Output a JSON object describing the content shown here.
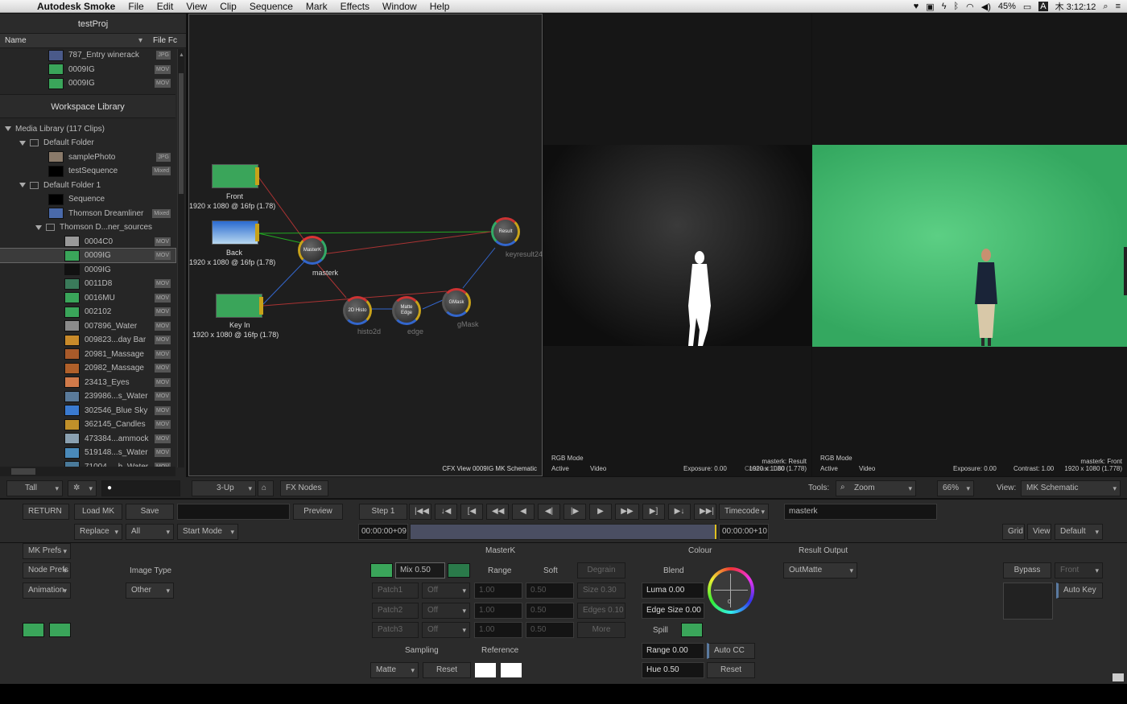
{
  "menubar": {
    "app": "Autodesk Smoke",
    "items": [
      "File",
      "Edit",
      "View",
      "Clip",
      "Sequence",
      "Mark",
      "Effects",
      "Window",
      "Help"
    ],
    "battery": "45%",
    "input": "A",
    "clock": "木 3:12:12"
  },
  "library": {
    "project": "testProj",
    "col_name": "Name",
    "col_format": "File Fc",
    "top_items": [
      {
        "name": "787_Entry winerack",
        "tag": "JPG",
        "thumb": "#4a5a8a"
      },
      {
        "name": "0009IG",
        "tag": "MOV",
        "thumb": "#3aa55a"
      },
      {
        "name": "0009IG",
        "tag": "MOV",
        "thumb": "#3aa55a"
      }
    ],
    "workspace": "Workspace Library",
    "media_root": "Media Library (117 Clips)",
    "folder1": "Default Folder",
    "folder1_items": [
      {
        "name": "samplePhoto",
        "tag": "JPG",
        "thumb": "#8a7a6a"
      },
      {
        "name": "testSequence",
        "tag": "Mixed",
        "thumb": "#000"
      }
    ],
    "folder2": "Default Folder 1",
    "folder2_items": [
      {
        "name": "Sequence",
        "tag": "",
        "thumb": "#000"
      },
      {
        "name": "Thomson Dreamliner",
        "tag": "Mixed",
        "thumb": "#4a6aaa"
      }
    ],
    "subfolder": "Thomson D...ner_sources",
    "clips": [
      {
        "name": "0004C0",
        "tag": "MOV",
        "thumb": "#999"
      },
      {
        "name": "0009IG",
        "tag": "MOV",
        "thumb": "#3aa55a"
      },
      {
        "name": "0009IG",
        "tag": "",
        "thumb": "#111"
      },
      {
        "name": "0011D8",
        "tag": "MOV",
        "thumb": "#3a7a5a"
      },
      {
        "name": "0016MU",
        "tag": "MOV",
        "thumb": "#3aa55a"
      },
      {
        "name": "002102",
        "tag": "MOV",
        "thumb": "#3aa55a"
      },
      {
        "name": "007896_Water",
        "tag": "MOV",
        "thumb": "#8a8a8a"
      },
      {
        "name": "009823...day Bar",
        "tag": "MOV",
        "thumb": "#c88a2a"
      },
      {
        "name": "20981_Massage",
        "tag": "MOV",
        "thumb": "#a85a2a"
      },
      {
        "name": "20982_Massage",
        "tag": "MOV",
        "thumb": "#b0602a"
      },
      {
        "name": "23413_Eyes",
        "tag": "MOV",
        "thumb": "#d07a4a"
      },
      {
        "name": "239986...s_Water",
        "tag": "MOV",
        "thumb": "#5a7a9a"
      },
      {
        "name": "302546_Blue Sky",
        "tag": "MOV",
        "thumb": "#3a7ad0"
      },
      {
        "name": "362145_Candles",
        "tag": "MOV",
        "thumb": "#c0902a"
      },
      {
        "name": "473384...ammock",
        "tag": "MOV",
        "thumb": "#8aa0b0"
      },
      {
        "name": "519148...s_Water",
        "tag": "MOV",
        "thumb": "#4a8aba"
      },
      {
        "name": "71004_...h_Water",
        "tag": "MOV",
        "thumb": "#4a7a9a"
      }
    ]
  },
  "schematic": {
    "nodes": {
      "front": "Front",
      "front_res": "1920 x 1080 @ 16fp (1.78)",
      "back": "Back",
      "back_res": "1920 x 1080 @ 16fp (1.78)",
      "keyin": "Key In",
      "keyin_res": "1920 x 1080 @ 16fp (1.78)",
      "masterk": "masterk",
      "masterk_inner": "MasterK",
      "result": "keyresult24",
      "result_inner": "Result",
      "histo": "histo2d",
      "histo_inner": "2D Histo",
      "edge": "edge",
      "edge_inner": "Matte Edge",
      "gmask": "gMask",
      "gmask_inner": "GMask"
    },
    "caption": "CFX View 0009IG MK Schematic"
  },
  "viewer1": {
    "mode": "RGB Mode",
    "active": "Active",
    "video": "Video",
    "name": "masterk: Result",
    "exposure": "Exposure: 0.00",
    "res": "1920 x 1080 (1.778)",
    "overlap": "Contrast: 1.00"
  },
  "viewer2": {
    "mode": "RGB Mode",
    "active": "Active",
    "video": "Video",
    "name": "masterk: Front",
    "exposure": "Exposure: 0.00",
    "contrast": "Contrast: 1.00",
    "res": "1920 x 1080 (1.778)"
  },
  "toolbar": {
    "tall": "Tall",
    "layout": "3-Up",
    "fx_nodes": "FX Nodes",
    "tools_label": "Tools:",
    "tool": "Zoom",
    "zoom": "66%",
    "view_label": "View:",
    "view": "MK Schematic"
  },
  "transport": {
    "return": "RETURN",
    "load_mk": "Load MK",
    "save": "Save",
    "preview": "Preview",
    "step": "Step 1",
    "timecode": "Timecode",
    "clip_name": "masterk",
    "replace": "Replace",
    "all": "All",
    "start_mode": "Start Mode",
    "tc_in": "00:00:00+09",
    "tc_out": "00:00:00+10",
    "grid": "Grid",
    "view": "View",
    "default": "Default"
  },
  "panel": {
    "mk_prefs": "MK Prefs",
    "node_prefs": "Node Prefs",
    "animation": "Animation",
    "image_type_label": "Image Type",
    "image_type": "Other",
    "masterk_title": "MasterK",
    "mix": "Mix 0.50",
    "range": "Range",
    "soft": "Soft",
    "degrain": "Degrain",
    "patch1": "Patch1",
    "patch2": "Patch2",
    "patch3": "Patch3",
    "off": "Off",
    "one": "1.00",
    "half": "0.50",
    "size": "Size 0.30",
    "edges": "Edges 0.10",
    "more": "More",
    "sampling": "Sampling",
    "reference": "Reference",
    "matte": "Matte",
    "reset": "Reset",
    "colour": "Colour",
    "blend": "Blend",
    "luma": "Luma 0.00",
    "edge_size": "Edge Size 0.00",
    "spill": "Spill",
    "range_val": "Range 0.00",
    "auto_cc": "Auto CC",
    "hue": "Hue 0.50",
    "reset2": "Reset",
    "wheel_val": "0",
    "result_output": "Result Output",
    "outmatte": "OutMatte",
    "bypass": "Bypass",
    "front": "Front",
    "auto_key": "Auto Key"
  }
}
